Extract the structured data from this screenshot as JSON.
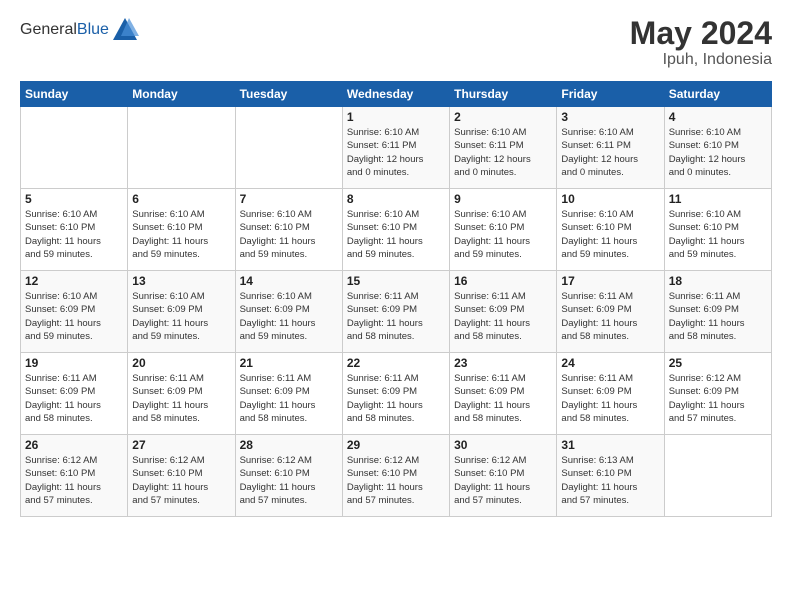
{
  "header": {
    "logo": {
      "general": "General",
      "blue": "Blue"
    },
    "title": "May 2024",
    "location": "Ipuh, Indonesia"
  },
  "calendar": {
    "weekdays": [
      "Sunday",
      "Monday",
      "Tuesday",
      "Wednesday",
      "Thursday",
      "Friday",
      "Saturday"
    ],
    "weeks": [
      [
        {
          "day": "",
          "info": ""
        },
        {
          "day": "",
          "info": ""
        },
        {
          "day": "",
          "info": ""
        },
        {
          "day": "1",
          "info": "Sunrise: 6:10 AM\nSunset: 6:11 PM\nDaylight: 12 hours\nand 0 minutes."
        },
        {
          "day": "2",
          "info": "Sunrise: 6:10 AM\nSunset: 6:11 PM\nDaylight: 12 hours\nand 0 minutes."
        },
        {
          "day": "3",
          "info": "Sunrise: 6:10 AM\nSunset: 6:11 PM\nDaylight: 12 hours\nand 0 minutes."
        },
        {
          "day": "4",
          "info": "Sunrise: 6:10 AM\nSunset: 6:10 PM\nDaylight: 12 hours\nand 0 minutes."
        }
      ],
      [
        {
          "day": "5",
          "info": "Sunrise: 6:10 AM\nSunset: 6:10 PM\nDaylight: 11 hours\nand 59 minutes."
        },
        {
          "day": "6",
          "info": "Sunrise: 6:10 AM\nSunset: 6:10 PM\nDaylight: 11 hours\nand 59 minutes."
        },
        {
          "day": "7",
          "info": "Sunrise: 6:10 AM\nSunset: 6:10 PM\nDaylight: 11 hours\nand 59 minutes."
        },
        {
          "day": "8",
          "info": "Sunrise: 6:10 AM\nSunset: 6:10 PM\nDaylight: 11 hours\nand 59 minutes."
        },
        {
          "day": "9",
          "info": "Sunrise: 6:10 AM\nSunset: 6:10 PM\nDaylight: 11 hours\nand 59 minutes."
        },
        {
          "day": "10",
          "info": "Sunrise: 6:10 AM\nSunset: 6:10 PM\nDaylight: 11 hours\nand 59 minutes."
        },
        {
          "day": "11",
          "info": "Sunrise: 6:10 AM\nSunset: 6:10 PM\nDaylight: 11 hours\nand 59 minutes."
        }
      ],
      [
        {
          "day": "12",
          "info": "Sunrise: 6:10 AM\nSunset: 6:09 PM\nDaylight: 11 hours\nand 59 minutes."
        },
        {
          "day": "13",
          "info": "Sunrise: 6:10 AM\nSunset: 6:09 PM\nDaylight: 11 hours\nand 59 minutes."
        },
        {
          "day": "14",
          "info": "Sunrise: 6:10 AM\nSunset: 6:09 PM\nDaylight: 11 hours\nand 59 minutes."
        },
        {
          "day": "15",
          "info": "Sunrise: 6:11 AM\nSunset: 6:09 PM\nDaylight: 11 hours\nand 58 minutes."
        },
        {
          "day": "16",
          "info": "Sunrise: 6:11 AM\nSunset: 6:09 PM\nDaylight: 11 hours\nand 58 minutes."
        },
        {
          "day": "17",
          "info": "Sunrise: 6:11 AM\nSunset: 6:09 PM\nDaylight: 11 hours\nand 58 minutes."
        },
        {
          "day": "18",
          "info": "Sunrise: 6:11 AM\nSunset: 6:09 PM\nDaylight: 11 hours\nand 58 minutes."
        }
      ],
      [
        {
          "day": "19",
          "info": "Sunrise: 6:11 AM\nSunset: 6:09 PM\nDaylight: 11 hours\nand 58 minutes."
        },
        {
          "day": "20",
          "info": "Sunrise: 6:11 AM\nSunset: 6:09 PM\nDaylight: 11 hours\nand 58 minutes."
        },
        {
          "day": "21",
          "info": "Sunrise: 6:11 AM\nSunset: 6:09 PM\nDaylight: 11 hours\nand 58 minutes."
        },
        {
          "day": "22",
          "info": "Sunrise: 6:11 AM\nSunset: 6:09 PM\nDaylight: 11 hours\nand 58 minutes."
        },
        {
          "day": "23",
          "info": "Sunrise: 6:11 AM\nSunset: 6:09 PM\nDaylight: 11 hours\nand 58 minutes."
        },
        {
          "day": "24",
          "info": "Sunrise: 6:11 AM\nSunset: 6:09 PM\nDaylight: 11 hours\nand 58 minutes."
        },
        {
          "day": "25",
          "info": "Sunrise: 6:12 AM\nSunset: 6:09 PM\nDaylight: 11 hours\nand 57 minutes."
        }
      ],
      [
        {
          "day": "26",
          "info": "Sunrise: 6:12 AM\nSunset: 6:10 PM\nDaylight: 11 hours\nand 57 minutes."
        },
        {
          "day": "27",
          "info": "Sunrise: 6:12 AM\nSunset: 6:10 PM\nDaylight: 11 hours\nand 57 minutes."
        },
        {
          "day": "28",
          "info": "Sunrise: 6:12 AM\nSunset: 6:10 PM\nDaylight: 11 hours\nand 57 minutes."
        },
        {
          "day": "29",
          "info": "Sunrise: 6:12 AM\nSunset: 6:10 PM\nDaylight: 11 hours\nand 57 minutes."
        },
        {
          "day": "30",
          "info": "Sunrise: 6:12 AM\nSunset: 6:10 PM\nDaylight: 11 hours\nand 57 minutes."
        },
        {
          "day": "31",
          "info": "Sunrise: 6:13 AM\nSunset: 6:10 PM\nDaylight: 11 hours\nand 57 minutes."
        },
        {
          "day": "",
          "info": ""
        }
      ]
    ]
  }
}
